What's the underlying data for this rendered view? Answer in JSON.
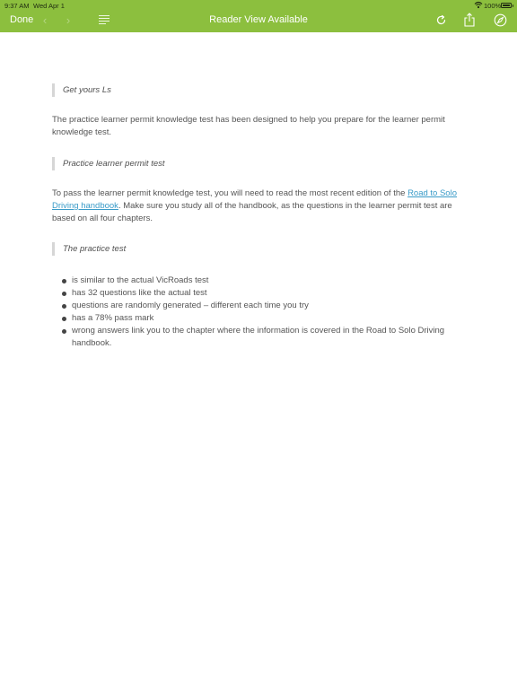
{
  "status_bar": {
    "time": "9:37 AM",
    "date": "Wed Apr 1",
    "battery": "100%"
  },
  "toolbar": {
    "done_label": "Done",
    "title": "Reader View Available",
    "icons": [
      "back-chevron-icon",
      "forward-chevron-icon",
      "list-icon",
      "refresh-icon",
      "share-icon",
      "compass-icon"
    ]
  },
  "colors": {
    "accent": "#8cbf3e",
    "link": "#3a9bc8"
  },
  "article": {
    "heading1": "Get yours Ls",
    "para1": "The practice learner permit knowledge test has been designed to help you prepare for the learner permit knowledge test.",
    "heading2": "Practice learner permit test",
    "para2_before": "To pass the learner permit knowledge test, you will need to read the most recent edition of the ",
    "para2_link": "Road to Solo Driving handbook",
    "para2_after": ". Make sure you study all of the handbook, as the questions in the learner permit test are based on all four chapters.",
    "heading3": "The practice test",
    "bullets": [
      "is similar to the actual VicRoads test",
      "has 32 questions like the actual test",
      "questions are randomly generated – different each time you try",
      "has a 78% pass mark",
      "wrong answers link you to the chapter where the information is covered in the Road to Solo Driving handbook."
    ]
  }
}
